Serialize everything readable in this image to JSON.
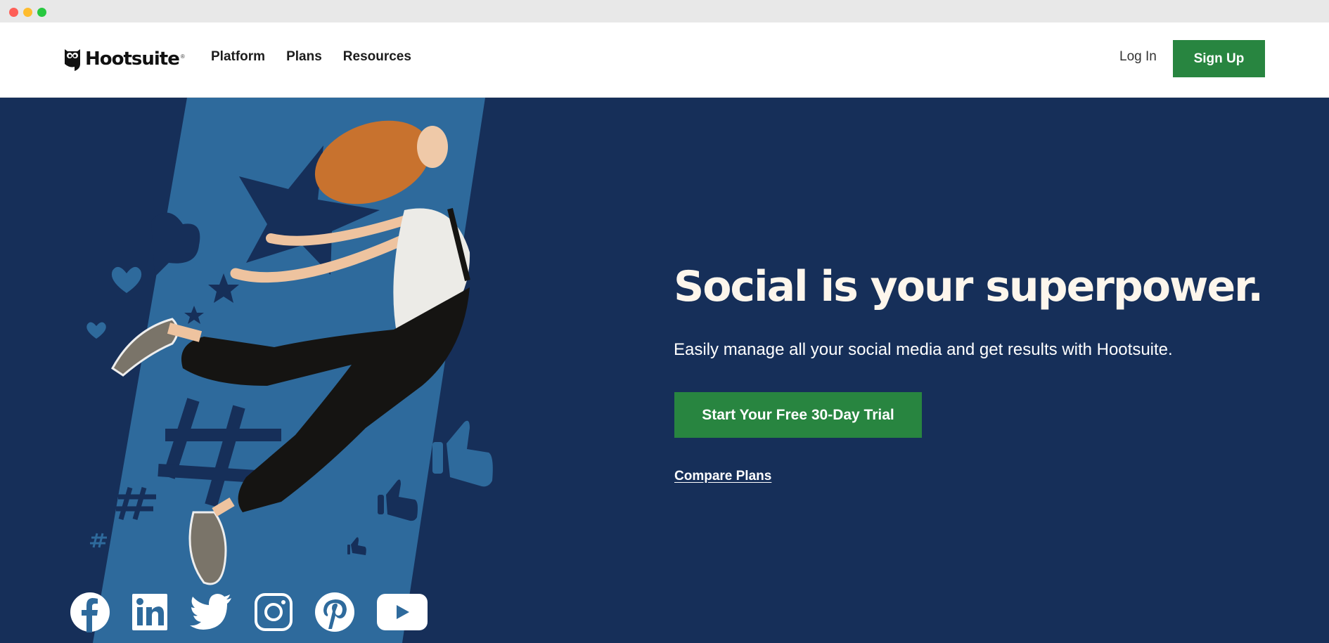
{
  "browser": {
    "window_controls": [
      "close",
      "minimize",
      "maximize"
    ]
  },
  "header": {
    "brand": "Hootsuite",
    "brand_mark": "®",
    "nav": [
      {
        "label": "Platform"
      },
      {
        "label": "Plans"
      },
      {
        "label": "Resources"
      }
    ],
    "login_label": "Log In",
    "signup_label": "Sign Up"
  },
  "hero": {
    "headline": "Social is your superpower.",
    "subtitle": "Easily manage all your social media and get results with Hootsuite.",
    "cta_label": "Start Your Free 30-Day Trial",
    "compare_label": "Compare Plans",
    "illustration": "woman-jumping-with-stars-hearts-hashtags-thumbs-up",
    "social_icons": [
      "facebook-icon",
      "linkedin-icon",
      "twitter-icon",
      "instagram-icon",
      "pinterest-icon",
      "youtube-icon"
    ]
  },
  "colors": {
    "brand_green": "#288540",
    "hero_navy": "#162f59",
    "hero_band_blue": "#2e6a9c",
    "headline_cream": "#fdf6ec"
  }
}
